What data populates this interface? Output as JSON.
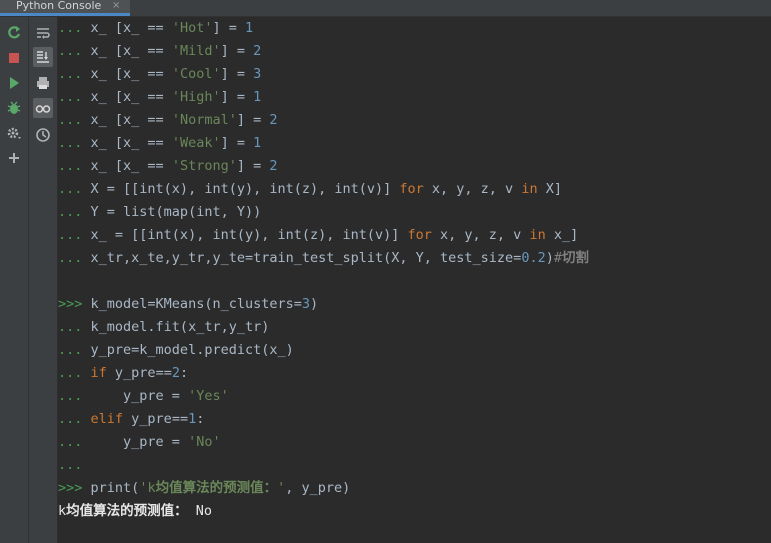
{
  "tab": {
    "title": "Python Console",
    "close": "×"
  },
  "lines": [
    {
      "prompt": "...",
      "segs": [
        {
          "t": "x_ [x_ == ",
          "c": "p"
        },
        {
          "t": "'Hot'",
          "c": "str"
        },
        {
          "t": "] = ",
          "c": "p"
        },
        {
          "t": "1",
          "c": "num"
        }
      ]
    },
    {
      "prompt": "...",
      "segs": [
        {
          "t": "x_ [x_ == ",
          "c": "p"
        },
        {
          "t": "'Mild'",
          "c": "str"
        },
        {
          "t": "] = ",
          "c": "p"
        },
        {
          "t": "2",
          "c": "num"
        }
      ]
    },
    {
      "prompt": "...",
      "segs": [
        {
          "t": "x_ [x_ == ",
          "c": "p"
        },
        {
          "t": "'Cool'",
          "c": "str"
        },
        {
          "t": "] = ",
          "c": "p"
        },
        {
          "t": "3",
          "c": "num"
        }
      ]
    },
    {
      "prompt": "...",
      "segs": [
        {
          "t": "x_ [x_ == ",
          "c": "p"
        },
        {
          "t": "'High'",
          "c": "str"
        },
        {
          "t": "] = ",
          "c": "p"
        },
        {
          "t": "1",
          "c": "num"
        }
      ]
    },
    {
      "prompt": "...",
      "segs": [
        {
          "t": "x_ [x_ == ",
          "c": "p"
        },
        {
          "t": "'Normal'",
          "c": "str"
        },
        {
          "t": "] = ",
          "c": "p"
        },
        {
          "t": "2",
          "c": "num"
        }
      ]
    },
    {
      "prompt": "...",
      "segs": [
        {
          "t": "x_ [x_ == ",
          "c": "p"
        },
        {
          "t": "'Weak'",
          "c": "str"
        },
        {
          "t": "] = ",
          "c": "p"
        },
        {
          "t": "1",
          "c": "num"
        }
      ]
    },
    {
      "prompt": "...",
      "segs": [
        {
          "t": "x_ [x_ == ",
          "c": "p"
        },
        {
          "t": "'Strong'",
          "c": "str"
        },
        {
          "t": "] = ",
          "c": "p"
        },
        {
          "t": "2",
          "c": "num"
        }
      ]
    },
    {
      "prompt": "...",
      "segs": [
        {
          "t": "X = [[int(x), int(y), int(z), int(v)] ",
          "c": "p"
        },
        {
          "t": "for",
          "c": "kw"
        },
        {
          "t": " x, y, z, v ",
          "c": "p"
        },
        {
          "t": "in",
          "c": "kw"
        },
        {
          "t": " X]",
          "c": "p"
        }
      ]
    },
    {
      "prompt": "...",
      "segs": [
        {
          "t": "Y = list(map(int, Y))",
          "c": "p"
        }
      ]
    },
    {
      "prompt": "...",
      "segs": [
        {
          "t": "x_ = [[int(x), int(y), int(z), int(v)] ",
          "c": "p"
        },
        {
          "t": "for",
          "c": "kw"
        },
        {
          "t": " x, y, z, v ",
          "c": "p"
        },
        {
          "t": "in",
          "c": "kw"
        },
        {
          "t": " x_]",
          "c": "p"
        }
      ]
    },
    {
      "prompt": "...",
      "segs": [
        {
          "t": "x_tr,x_te,y_tr,y_te=train_test_split(X, Y, test_size=",
          "c": "p"
        },
        {
          "t": "0.2",
          "c": "num"
        },
        {
          "t": ")",
          "c": "p"
        },
        {
          "t": "#",
          "c": "cm"
        },
        {
          "t": "切割",
          "c": "cmcjk"
        }
      ]
    },
    {
      "prompt": "",
      "segs": []
    },
    {
      "prompt": ">>>",
      "segs": [
        {
          "t": "k_model=KMeans(n_clusters=",
          "c": "p"
        },
        {
          "t": "3",
          "c": "num"
        },
        {
          "t": ")",
          "c": "p"
        }
      ]
    },
    {
      "prompt": "...",
      "segs": [
        {
          "t": "k_model.fit(x_tr,y_tr)",
          "c": "p"
        }
      ]
    },
    {
      "prompt": "...",
      "segs": [
        {
          "t": "y_pre=k_model.predict(x_)",
          "c": "p"
        }
      ]
    },
    {
      "prompt": "...",
      "segs": [
        {
          "t": "if",
          "c": "kw"
        },
        {
          "t": " y_pre==",
          "c": "p"
        },
        {
          "t": "2",
          "c": "num"
        },
        {
          "t": ":",
          "c": "p"
        }
      ]
    },
    {
      "prompt": "...",
      "segs": [
        {
          "t": "    y_pre = ",
          "c": "p"
        },
        {
          "t": "'Yes'",
          "c": "str"
        }
      ]
    },
    {
      "prompt": "...",
      "segs": [
        {
          "t": "elif",
          "c": "kw"
        },
        {
          "t": " y_pre==",
          "c": "p"
        },
        {
          "t": "1",
          "c": "num"
        },
        {
          "t": ":",
          "c": "p"
        }
      ]
    },
    {
      "prompt": "...",
      "segs": [
        {
          "t": "    y_pre = ",
          "c": "p"
        },
        {
          "t": "'No'",
          "c": "str"
        }
      ]
    },
    {
      "prompt": "...",
      "segs": []
    },
    {
      "prompt": ">>>",
      "segs": [
        {
          "t": "print(",
          "c": "p"
        },
        {
          "t": "'k",
          "c": "str"
        },
        {
          "t": "均值算法的预测值：",
          "c": "strcjk"
        },
        {
          "t": "'",
          "c": "str"
        },
        {
          "t": ", y_pre)",
          "c": "p"
        }
      ]
    },
    {
      "prompt": "",
      "segs": [
        {
          "t": "k",
          "c": "out"
        },
        {
          "t": "均值算法的预测值：",
          "c": "outcjk"
        },
        {
          "t": " No",
          "c": "out"
        }
      ],
      "output": true
    }
  ],
  "icons": {
    "toolbar1": [
      "rerun-icon",
      "stop-icon",
      "run-icon",
      "debug-icon",
      "settings-icon",
      "add-icon"
    ],
    "toolbar2": [
      "soft-wrap-icon",
      "scroll-to-end-icon",
      "print-icon",
      "show-variables-icon",
      "history-icon"
    ]
  },
  "colors": {
    "background": "#2b2b2b",
    "prompt": "#499c54",
    "string": "#6a8759",
    "number": "#6897bb",
    "keyword": "#cc7832",
    "text": "#a9b7c6"
  }
}
